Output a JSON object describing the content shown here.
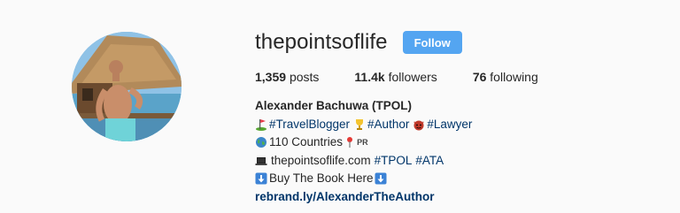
{
  "profile": {
    "username": "thepointsoflife",
    "follow_label": "Follow",
    "stats": {
      "posts_count": "1,359",
      "posts_label": "posts",
      "followers_count": "11.4k",
      "followers_label": "followers",
      "following_count": "76",
      "following_label": "following"
    },
    "bio": {
      "full_name": "Alexander Bachuwa (TPOL)",
      "line2": {
        "tag1": "#TravelBlogger",
        "tag2": "#Author",
        "tag3": "#Lawyer"
      },
      "line3": {
        "text": "110 Countries",
        "flag_text": "PR"
      },
      "line4": {
        "site": "thepointsoflife.com",
        "tag1": "#TPOL",
        "tag2": "#ATA"
      },
      "line5": {
        "text": "Buy The Book Here"
      },
      "link": "rebrand.ly/AlexanderTheAuthor"
    }
  },
  "icons": {
    "golf": "golf-flag-icon",
    "trophy": "trophy-icon",
    "devil": "devil-face-icon",
    "globe": "globe-icon",
    "pin": "pushpin-icon",
    "laptop": "laptop-icon",
    "down_arrow": "down-arrow-icon"
  },
  "colors": {
    "follow_button": "#3897f0",
    "hashtag": "#003569",
    "text": "#262626",
    "background": "#fafafa"
  }
}
